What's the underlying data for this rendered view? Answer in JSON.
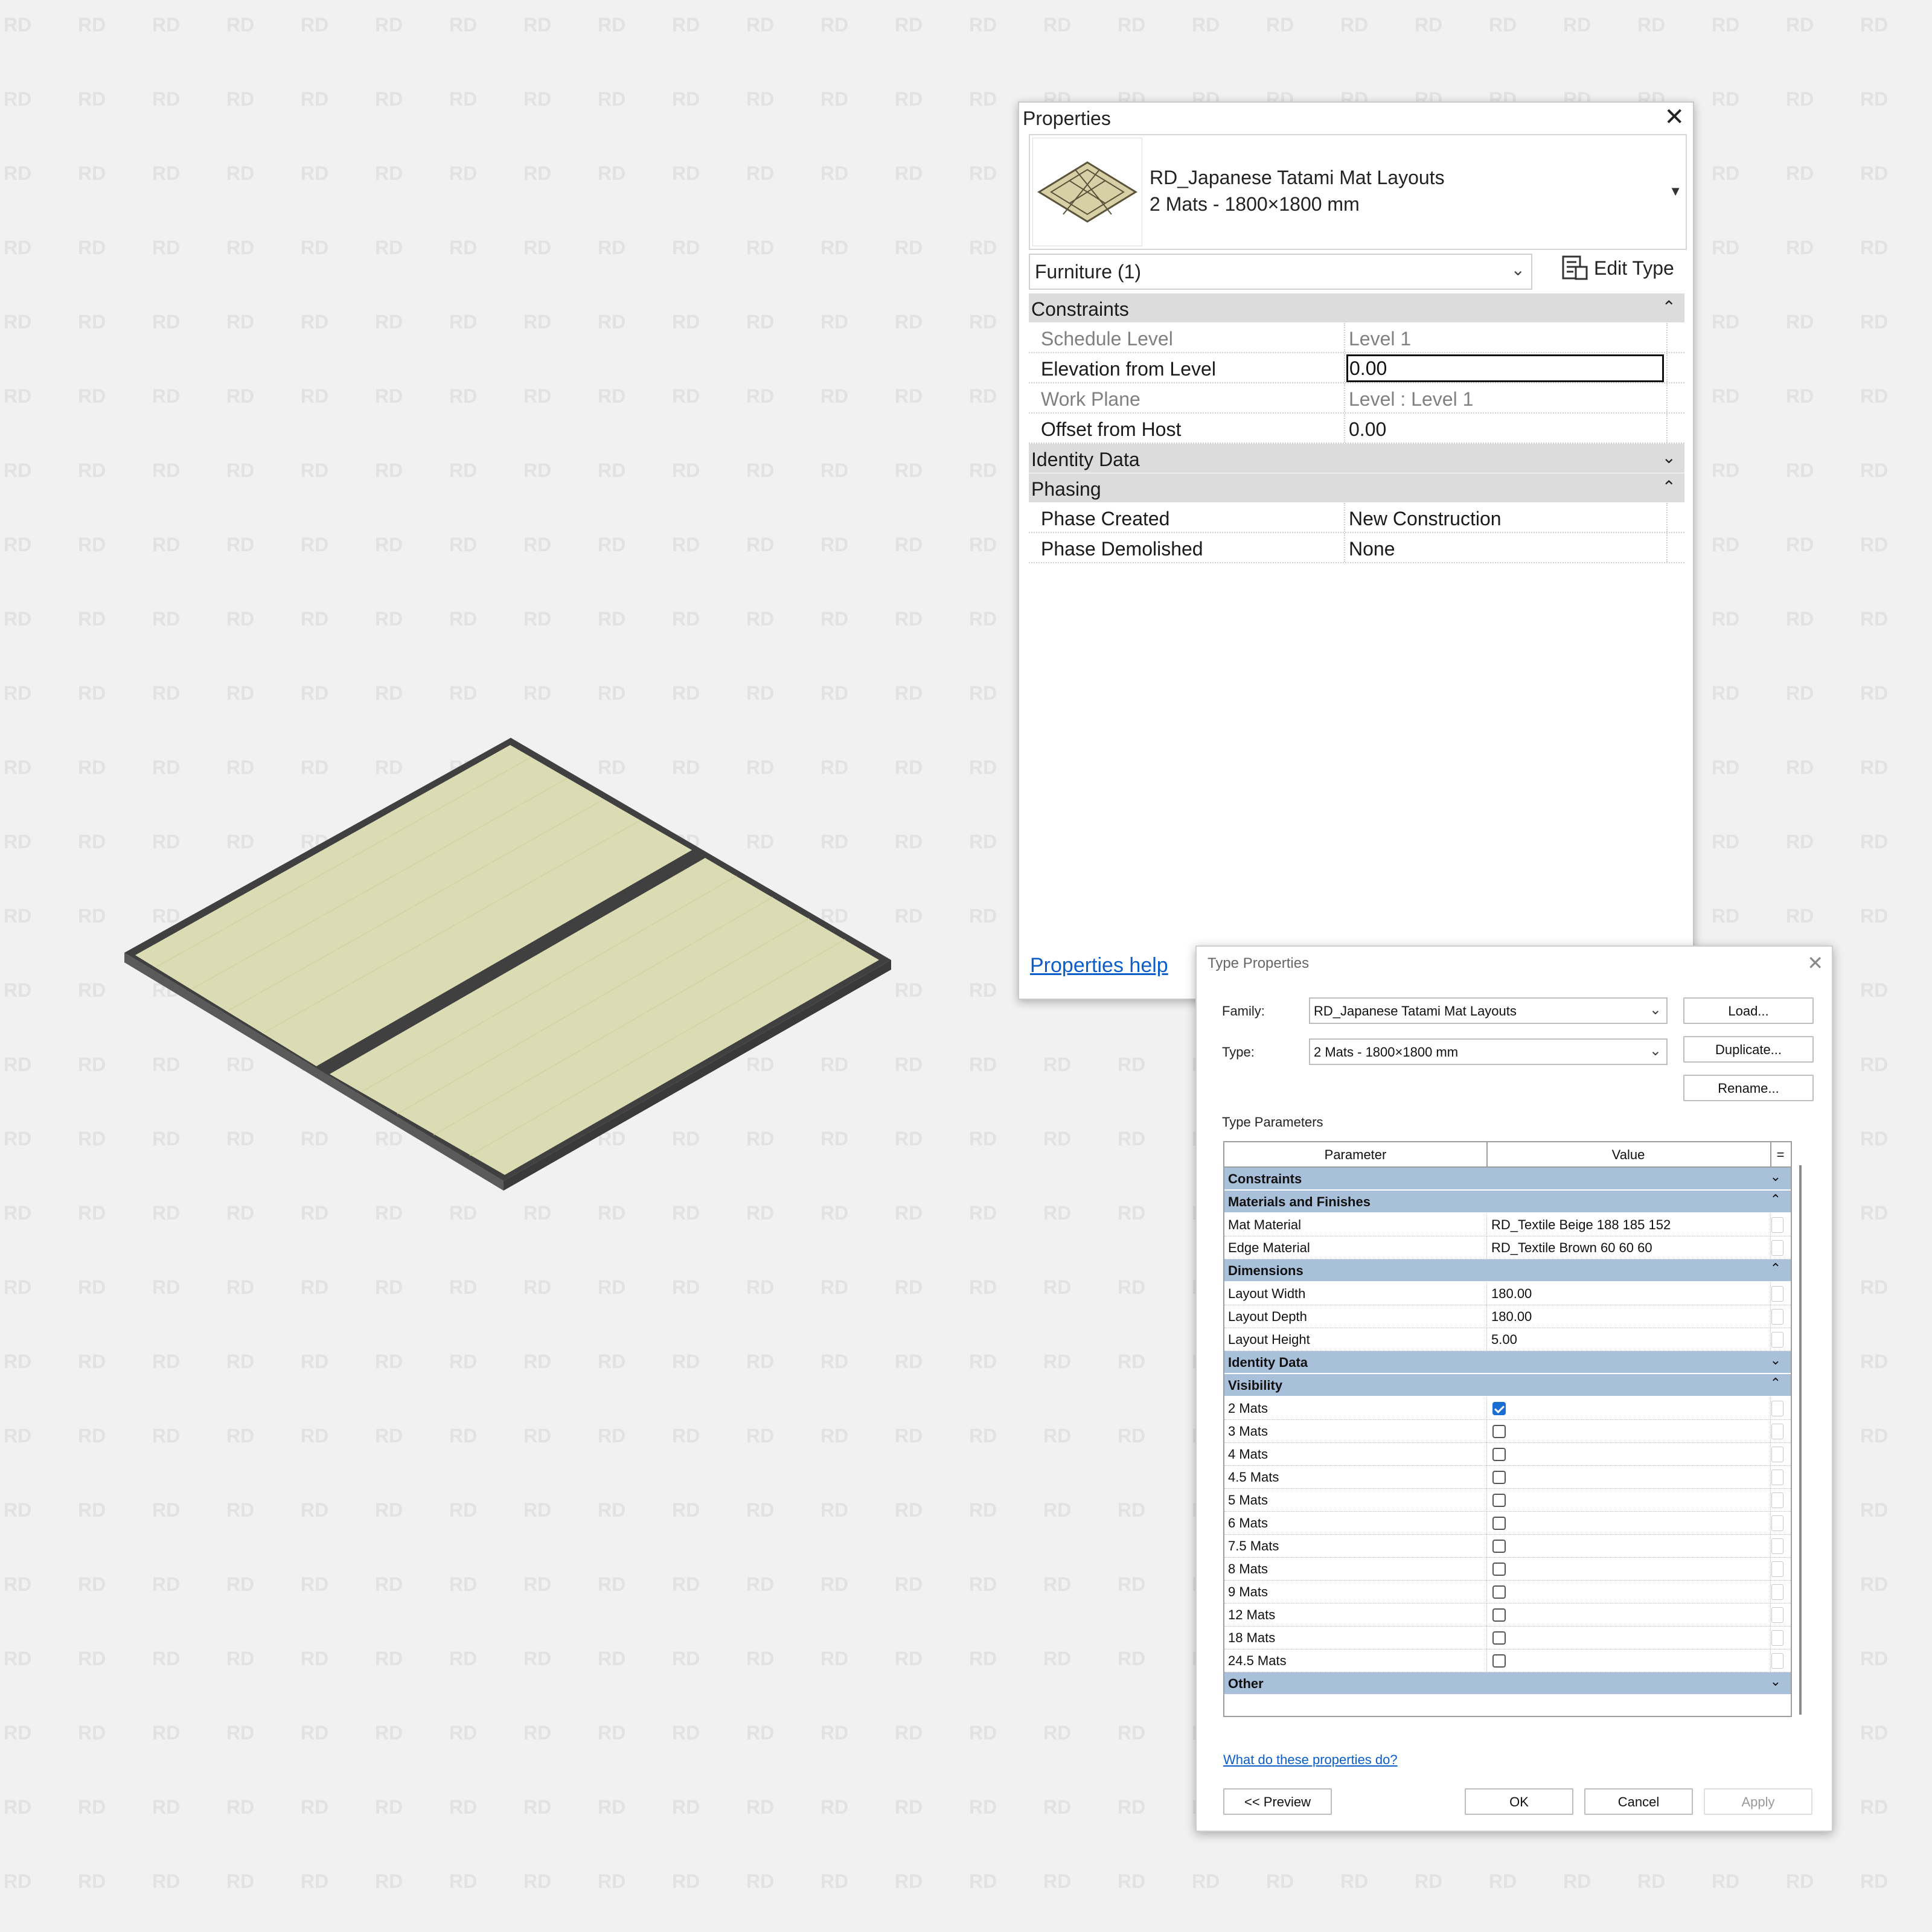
{
  "watermark": "RD",
  "colors": {
    "background": "#f1f1f1",
    "mat": "#dcdcb4",
    "edge": "#3c3c3c",
    "group_header": "#a9c0da",
    "link": "#0b5ec9",
    "checkbox_on": "#1a6ed1"
  },
  "properties": {
    "title": "Properties",
    "close_icon": "close-icon",
    "type_selector": {
      "family": "RD_Japanese Tatami Mat Layouts",
      "type": "2 Mats - 1800×1800 mm"
    },
    "filter": "Furniture (1)",
    "edit_type_label": "Edit Type",
    "groups": {
      "constraints": "Constraints",
      "identity_data": "Identity Data",
      "phasing": "Phasing"
    },
    "rows": {
      "schedule_level": {
        "name": "Schedule Level",
        "value": "Level 1"
      },
      "elevation_from_level": {
        "name": "Elevation from Level",
        "value": "0.00"
      },
      "work_plane": {
        "name": "Work Plane",
        "value": "Level : Level 1"
      },
      "offset_from_host": {
        "name": "Offset from Host",
        "value": "0.00"
      },
      "phase_created": {
        "name": "Phase Created",
        "value": "New Construction"
      },
      "phase_demolished": {
        "name": "Phase Demolished",
        "value": "None"
      }
    },
    "help_link": "Properties help"
  },
  "type_properties": {
    "title": "Type Properties",
    "family_label": "Family:",
    "family_value": "RD_Japanese Tatami Mat Layouts",
    "type_label": "Type:",
    "type_value": "2 Mats - 1800×1800 mm",
    "load_button": "Load...",
    "duplicate_button": "Duplicate...",
    "rename_button": "Rename...",
    "section_label": "Type Parameters",
    "col_parameter": "Parameter",
    "col_value": "Value",
    "col_extra": "=",
    "groups": {
      "constraints": "Constraints",
      "materials": "Materials and Finishes",
      "dimensions": "Dimensions",
      "identity_data": "Identity Data",
      "visibility": "Visibility",
      "other": "Other"
    },
    "materials": {
      "mat_material": {
        "name": "Mat Material",
        "value": "RD_Textile Beige 188 185 152"
      },
      "edge_material": {
        "name": "Edge Material",
        "value": "RD_Textile Brown 60 60 60"
      }
    },
    "dimensions": {
      "layout_width": {
        "name": "Layout Width",
        "value": "180.00"
      },
      "layout_depth": {
        "name": "Layout Depth",
        "value": "180.00"
      },
      "layout_height": {
        "name": "Layout Height",
        "value": "5.00"
      }
    },
    "visibility": [
      {
        "name": "2 Mats",
        "checked": true
      },
      {
        "name": "3 Mats",
        "checked": false
      },
      {
        "name": "4 Mats",
        "checked": false
      },
      {
        "name": "4.5 Mats",
        "checked": false
      },
      {
        "name": "5 Mats",
        "checked": false
      },
      {
        "name": "6 Mats",
        "checked": false
      },
      {
        "name": "7.5 Mats",
        "checked": false
      },
      {
        "name": "8 Mats",
        "checked": false
      },
      {
        "name": "9 Mats",
        "checked": false
      },
      {
        "name": "12 Mats",
        "checked": false
      },
      {
        "name": "18 Mats",
        "checked": false
      },
      {
        "name": "24.5 Mats",
        "checked": false
      }
    ],
    "help_link": "What do these properties do?",
    "preview_button": "<< Preview",
    "ok_button": "OK",
    "cancel_button": "Cancel",
    "apply_button": "Apply"
  }
}
